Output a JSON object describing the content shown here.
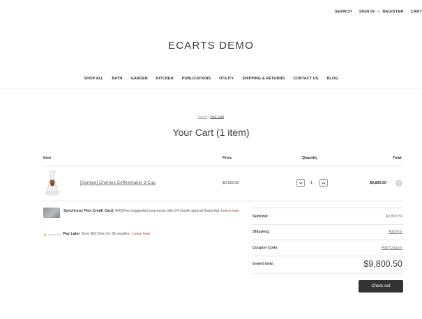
{
  "topbar": {
    "search": "SEARCH",
    "sign_in": "SIGN IN",
    "or": "or",
    "register": "REGISTER",
    "cart": "CART"
  },
  "store": {
    "title": "ECARTS DEMO"
  },
  "nav": [
    "SHOP ALL",
    "BATH",
    "GARDEN",
    "KITCHEN",
    "PUBLICATIONS",
    "UTILITY",
    "SHIPPING & RETURNS",
    "CONTACT US",
    "BLOG"
  ],
  "breadcrumb": {
    "home": "Home",
    "separator": "/",
    "current": "Your Cart"
  },
  "page": {
    "heading": "Your Cart (1 item)"
  },
  "cart": {
    "columns": {
      "item": "Item",
      "price": "Price",
      "quantity": "Quantity",
      "total": "Total"
    },
    "items": [
      {
        "name": "[Sample] Chemex Coffeemaker 3 Cup",
        "price": "$9,800.50",
        "quantity": "1",
        "total": "$9,800.50"
      }
    ]
  },
  "financing": {
    "card_title": "Synchrony Flex Credit Card:",
    "card_text": "$409/mo suggested payments with 24 month special financing.",
    "learn_how": "Learn how",
    "paylater_brand": "synchrony",
    "paylater_title": "Pay Later",
    "paylater_text": "from $317/mo for 36 months."
  },
  "summary": {
    "subtotal_label": "Subtotal:",
    "subtotal_value": "$9,800.50",
    "shipping_label": "Shipping:",
    "shipping_link": "Add Info",
    "coupon_label": "Coupon Code:",
    "coupon_link": "Add Coupon",
    "grand_label": "Grand total:",
    "grand_value": "$9,800.50"
  },
  "actions": {
    "checkout": "Check out"
  },
  "colors": {
    "accent_link": "#b5381f",
    "button_bg": "#333333",
    "rule": "#e6e6e6"
  }
}
